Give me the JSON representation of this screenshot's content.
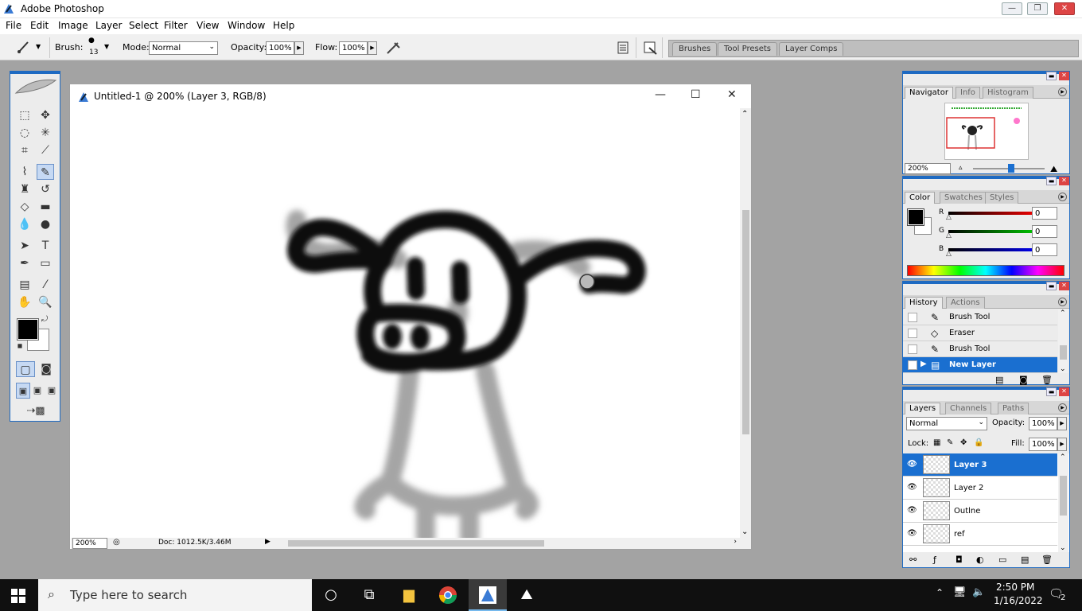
{
  "app": {
    "title": "Adobe Photoshop"
  },
  "menu": [
    "File",
    "Edit",
    "Image",
    "Layer",
    "Select",
    "Filter",
    "View",
    "Window",
    "Help"
  ],
  "options": {
    "brush_label": "Brush:",
    "brush_size": "13",
    "mode_label": "Mode:",
    "mode_value": "Normal",
    "opacity_label": "Opacity:",
    "opacity_value": "100%",
    "flow_label": "Flow:",
    "flow_value": "100%",
    "well_tabs": [
      "Brushes",
      "Tool Presets",
      "Layer Comps"
    ]
  },
  "document": {
    "title": "Untitled-1 @ 200% (Layer 3, RGB/8)",
    "zoom": "200%",
    "doc_info": "Doc: 1012.5K/3.46M"
  },
  "navigator": {
    "tabs": [
      "Navigator",
      "Info",
      "Histogram"
    ],
    "zoom": "200%"
  },
  "color": {
    "tabs": [
      "Color",
      "Swatches",
      "Styles"
    ],
    "channels": [
      {
        "label": "R",
        "value": "0",
        "color": "#e00000"
      },
      {
        "label": "G",
        "value": "0",
        "color": "#00b000"
      },
      {
        "label": "B",
        "value": "0",
        "color": "#0000d0"
      }
    ],
    "foreground": "#000000",
    "background": "#ffffff"
  },
  "history": {
    "tabs": [
      "History",
      "Actions"
    ],
    "items": [
      {
        "label": "Brush Tool",
        "icon": "brush-icon"
      },
      {
        "label": "Eraser",
        "icon": "eraser-icon"
      },
      {
        "label": "Brush Tool",
        "icon": "brush-icon"
      },
      {
        "label": "New Layer",
        "icon": "layer-icon"
      }
    ],
    "selected_index": 3
  },
  "layers": {
    "tabs": [
      "Layers",
      "Channels",
      "Paths"
    ],
    "blend_mode": "Normal",
    "opacity_label": "Opacity:",
    "opacity": "100%",
    "lock_label": "Lock:",
    "fill_label": "Fill:",
    "fill": "100%",
    "items": [
      {
        "name": "Layer 3",
        "visible": true
      },
      {
        "name": "Layer 2",
        "visible": true
      },
      {
        "name": "Outlne",
        "visible": true
      },
      {
        "name": "ref",
        "visible": true
      }
    ],
    "selected_index": 0
  },
  "taskbar": {
    "search_placeholder": "Type here to search",
    "time": "2:50 PM",
    "date": "1/16/2022",
    "notifications": "2"
  }
}
